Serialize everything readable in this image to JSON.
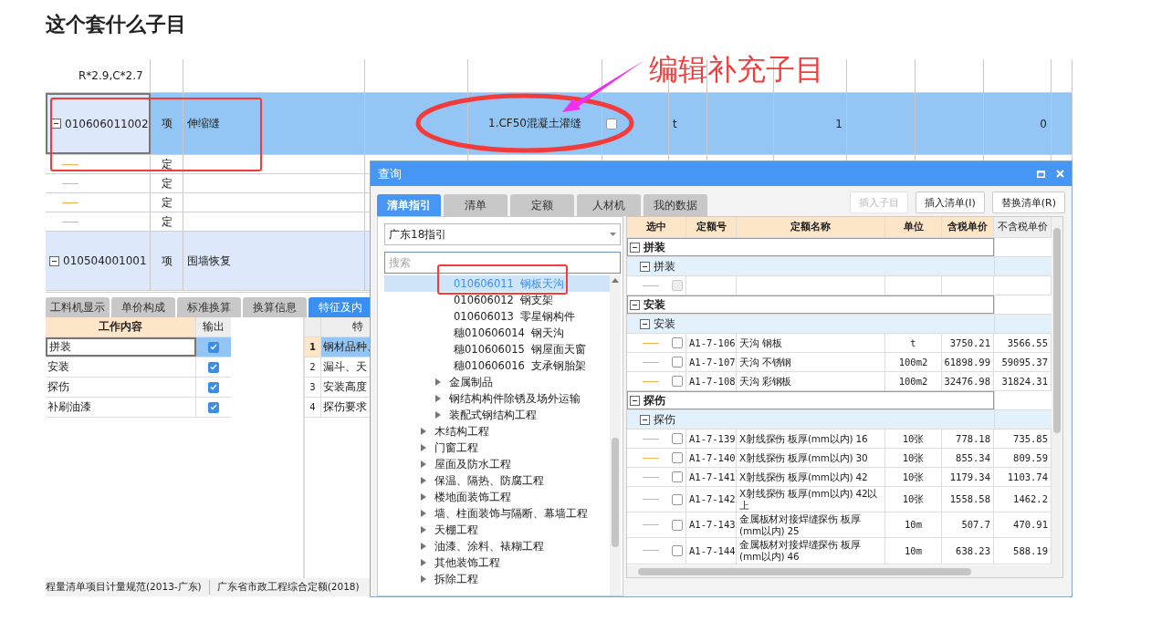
{
  "page_title": "这个套什么子目",
  "annotation": {
    "text": "编辑补充子目"
  },
  "grid_rows": [
    {
      "kind": "cut",
      "code": "R*2.9,C*2.7"
    },
    {
      "kind": "item",
      "expanded": true,
      "selected": true,
      "code": "010606011002",
      "type": "项",
      "name": "伸缩缝",
      "features": "1.CF50混凝土灌缝",
      "checked": false,
      "unit": "t",
      "quantity": "1",
      "total": "0"
    },
    {
      "kind": "sub",
      "type": "定"
    },
    {
      "kind": "sub",
      "type": "定"
    },
    {
      "kind": "sub",
      "type": "定"
    },
    {
      "kind": "sub",
      "type": "定"
    },
    {
      "kind": "item",
      "expanded": true,
      "selected": false,
      "code": "010504001001",
      "type": "项",
      "name": "围墙恢复"
    }
  ],
  "bottom_tabs": [
    {
      "label": "工料机显示",
      "selected": false
    },
    {
      "label": "单价构成",
      "selected": false
    },
    {
      "label": "标准换算",
      "selected": false
    },
    {
      "label": "换算信息",
      "selected": false
    },
    {
      "label": "特征及内",
      "selected": true
    }
  ],
  "work_table": {
    "columns": [
      "工作内容",
      "输出"
    ],
    "rows": [
      {
        "text": "拼装",
        "output": true,
        "selected": true
      },
      {
        "text": "安装",
        "output": true,
        "selected": false
      },
      {
        "text": "探伤",
        "output": true,
        "selected": false
      },
      {
        "text": "补刷油漆",
        "output": true,
        "selected": false
      }
    ]
  },
  "feature_table": {
    "column": "特",
    "rows": [
      {
        "no": "1",
        "text": "钢材品种、",
        "selected": true
      },
      {
        "no": "2",
        "text": "漏斗、天",
        "selected": false
      },
      {
        "no": "3",
        "text": "安装高度",
        "selected": false
      },
      {
        "no": "4",
        "text": "探伤要求",
        "selected": false
      }
    ]
  },
  "status_bar": [
    "程量清单项目计量规范(2013-广东)",
    "广东省市政工程综合定额(2018)"
  ],
  "dialog": {
    "title": "查询",
    "tabs": [
      {
        "label": "清单指引",
        "selected": true
      },
      {
        "label": "清单",
        "selected": false
      },
      {
        "label": "定额",
        "selected": false
      },
      {
        "label": "人材机",
        "selected": false
      },
      {
        "label": "我的数据",
        "selected": false
      }
    ],
    "buttons": [
      {
        "label": "插入子目",
        "disabled": true
      },
      {
        "label": "插入清单(I)",
        "disabled": false
      },
      {
        "label": "替换清单(R)",
        "disabled": false
      }
    ],
    "dropdown": "广东18指引",
    "search": {
      "placeholder": "搜索"
    },
    "tree": [
      {
        "children": [
          {
            "children": [
              {
                "label": "010606011  钢板天沟",
                "selected": true
              },
              {
                "label": "010606012  钢支架",
                "selected": false
              },
              {
                "label": "010606013  零星钢构件",
                "selected": false
              },
              {
                "label": "穗010606014  钢天沟",
                "selected": false
              },
              {
                "label": "穗010606015  钢屋面天窗",
                "selected": false
              },
              {
                "label": "穗010606016  支承钢胎架",
                "selected": false
              }
            ]
          },
          {
            "label": "金属制品",
            "expanded": false,
            "selected": false
          },
          {
            "label": "钢结构构件除锈及场外运输",
            "expanded": false,
            "selected": false
          },
          {
            "label": "装配式钢结构工程",
            "expanded": false,
            "selected": false
          }
        ]
      },
      {
        "label": "木结构工程",
        "expanded": false,
        "selected": false
      },
      {
        "label": "门窗工程",
        "expanded": false,
        "selected": false
      },
      {
        "label": "屋面及防水工程",
        "expanded": false,
        "selected": false
      },
      {
        "label": "保温、隔热、防腐工程",
        "expanded": false,
        "selected": false
      },
      {
        "label": "楼地面装饰工程",
        "expanded": false,
        "selected": false
      },
      {
        "label": "墙、柱面装饰与隔断、幕墙工程",
        "expanded": false,
        "selected": false
      },
      {
        "label": "天棚工程",
        "expanded": false,
        "selected": false
      },
      {
        "label": "油漆、涂料、裱糊工程",
        "expanded": false,
        "selected": false
      },
      {
        "label": "其他装饰工程",
        "expanded": false,
        "selected": false
      },
      {
        "label": "拆除工程",
        "expanded": false,
        "selected": false
      }
    ],
    "quota_table": {
      "columns": [
        {
          "label": "选中",
          "highlighted": true
        },
        {
          "label": "定额号",
          "highlighted": true
        },
        {
          "label": "定额名称",
          "highlighted": true
        },
        {
          "label": "单位",
          "highlighted": true
        },
        {
          "label": "含税单价",
          "highlighted": true
        },
        {
          "label": "不含税单价",
          "highlighted": false
        }
      ],
      "groups": [
        {
          "name": "拼装",
          "expanded": true,
          "children": [
            {
              "name": "拼装",
              "expanded": true,
              "rows": [
                {
                  "checked": false,
                  "disabled": true
                }
              ]
            }
          ]
        },
        {
          "name": "安装",
          "expanded": true,
          "children": [
            {
              "name": "安装",
              "expanded": true,
              "rows": [
                {
                  "checked": false,
                  "disabled": false,
                  "code": "A1-7-106",
                  "name": "天沟 钢板",
                  "unit": "t",
                  "price_tax": "3750.21",
                  "price_notax": "3566.55"
                },
                {
                  "checked": false,
                  "disabled": false,
                  "code": "A1-7-107",
                  "name": "天沟 不锈钢",
                  "unit": "100m2",
                  "price_tax": "61898.99",
                  "price_notax": "59095.37"
                },
                {
                  "checked": false,
                  "disabled": false,
                  "code": "A1-7-108",
                  "name": "天沟 彩钢板",
                  "unit": "100m2",
                  "price_tax": "32476.98",
                  "price_notax": "31824.31"
                }
              ]
            }
          ]
        },
        {
          "name": "探伤",
          "expanded": true,
          "children": [
            {
              "name": "探伤",
              "expanded": true,
              "rows": [
                {
                  "checked": false,
                  "disabled": false,
                  "code": "A1-7-139",
                  "name": "X射线探伤 板厚(mm以内) 16",
                  "unit": "10张",
                  "price_tax": "778.18",
                  "price_notax": "735.85"
                },
                {
                  "checked": false,
                  "disabled": false,
                  "code": "A1-7-140",
                  "name": "X射线探伤 板厚(mm以内) 30",
                  "unit": "10张",
                  "price_tax": "855.34",
                  "price_notax": "809.59"
                },
                {
                  "checked": false,
                  "disabled": false,
                  "code": "A1-7-141",
                  "name": "X射线探伤 板厚(mm以内) 42",
                  "unit": "10张",
                  "price_tax": "1179.34",
                  "price_notax": "1103.74"
                },
                {
                  "checked": false,
                  "disabled": false,
                  "code": "A1-7-142",
                  "name": "X射线探伤 板厚(mm以内) 42以上",
                  "unit": "10张",
                  "price_tax": "1558.58",
                  "price_notax": "1462.2"
                },
                {
                  "checked": false,
                  "disabled": false,
                  "code": "A1-7-143",
                  "name": "金属板材对接焊缝探伤 板厚(mm以内) 25",
                  "unit": "10m",
                  "price_tax": "507.7",
                  "price_notax": "470.91"
                },
                {
                  "checked": false,
                  "disabled": false,
                  "code": "A1-7-144",
                  "name": "金属板材对接焊缝探伤 板厚(mm以内) 46",
                  "unit": "10m",
                  "price_tax": "638.23",
                  "price_notax": "588.19"
                }
              ]
            }
          ]
        }
      ]
    }
  }
}
